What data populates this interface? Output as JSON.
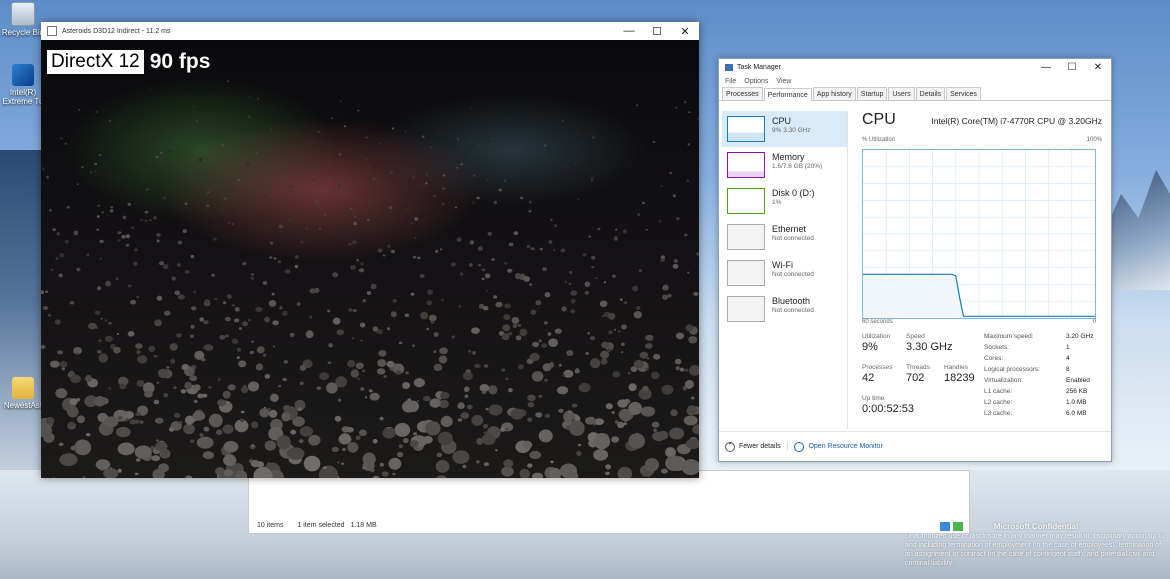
{
  "desktop": {
    "icons": [
      {
        "label": "Recycle Bin",
        "icon": "recycle-bin-icon"
      },
      {
        "label": "Intel(R) Extreme Tu",
        "icon": "intel-tuning-icon"
      },
      {
        "label": "NewestAst",
        "icon": "folder-icon"
      }
    ],
    "watermark": {
      "title": "Microsoft Confidential",
      "text": "Unauthorized use or disclosure in any manner may result in disciplinary action up to and including termination of employment (in the case of employees), termination of an assignment or contract (in the case of contingent staff), and potential civil and criminal liability."
    }
  },
  "dx_window": {
    "title": "Asteroids D3D12 Indirect - 11.2 ms",
    "badge": "DirectX 12",
    "fps": "90 fps",
    "controls": {
      "minimize": "—",
      "maximize": "☐",
      "close": "✕"
    }
  },
  "explorer": {
    "items_count": "10 items",
    "selected": "1 item selected",
    "size": "1.18 MB"
  },
  "task_manager": {
    "title": "Task Manager",
    "controls": {
      "minimize": "—",
      "maximize": "☐",
      "close": "✕"
    },
    "menu": [
      "File",
      "Options",
      "View"
    ],
    "tabs": [
      "Processes",
      "Performance",
      "App history",
      "Startup",
      "Users",
      "Details",
      "Services"
    ],
    "active_tab": "Performance",
    "resources": [
      {
        "name": "CPU",
        "sub": "9%  3.30 GHz",
        "color": "#117dbb"
      },
      {
        "name": "Memory",
        "sub": "1.6/7.8 GB (20%)",
        "color": "#8b12ae"
      },
      {
        "name": "Disk 0 (D:)",
        "sub": "1%",
        "color": "#4da60c"
      },
      {
        "name": "Ethernet",
        "sub": "Not connected",
        "color": "#aaaaaa"
      },
      {
        "name": "Wi-Fi",
        "sub": "Not connected",
        "color": "#aaaaaa"
      },
      {
        "name": "Bluetooth",
        "sub": "Not connected",
        "color": "#aaaaaa"
      }
    ],
    "cpu": {
      "heading": "CPU",
      "model": "Intel(R) Core(TM) i7-4770R CPU @ 3.20GHz",
      "graph_label": "% Utilization",
      "graph_max": "100%",
      "graph_time": "60 seconds",
      "graph_min": "0",
      "utilization_history": [
        {
          "t": 0,
          "v": 26
        },
        {
          "t": 22,
          "v": 26
        },
        {
          "t": 23,
          "v": 26
        },
        {
          "t": 24,
          "v": 25
        },
        {
          "t": 25,
          "v": 12
        },
        {
          "t": 26,
          "v": 1
        },
        {
          "t": 60,
          "v": 1
        }
      ],
      "stats": {
        "utilization_label": "Utilization",
        "utilization": "9%",
        "speed_label": "Speed",
        "speed": "3.30 GHz",
        "processes_label": "Processes",
        "processes": "42",
        "threads_label": "Threads",
        "threads": "702",
        "handles_label": "Handles",
        "handles": "18239",
        "uptime_label": "Up time",
        "uptime": "0:00:52:53"
      },
      "details": [
        {
          "k": "Maximum speed:",
          "v": "3.20 GHz"
        },
        {
          "k": "Sockets:",
          "v": "1"
        },
        {
          "k": "Cores:",
          "v": "4"
        },
        {
          "k": "Logical processors:",
          "v": "8"
        },
        {
          "k": "Virtualization:",
          "v": "Enabled"
        },
        {
          "k": "L1 cache:",
          "v": "256 KB"
        },
        {
          "k": "L2 cache:",
          "v": "1.0 MB"
        },
        {
          "k": "L3 cache:",
          "v": "6.0 MB"
        }
      ]
    },
    "footer": {
      "fewer": "Fewer details",
      "monitor": "Open Resource Monitor"
    }
  }
}
